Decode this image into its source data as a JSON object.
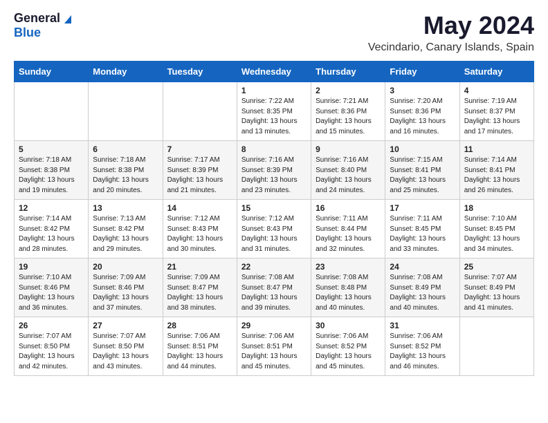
{
  "logo": {
    "general": "General",
    "blue": "Blue"
  },
  "title": {
    "month": "May 2024",
    "location": "Vecindario, Canary Islands, Spain"
  },
  "header": {
    "days": [
      "Sunday",
      "Monday",
      "Tuesday",
      "Wednesday",
      "Thursday",
      "Friday",
      "Saturday"
    ]
  },
  "weeks": [
    {
      "cells": [
        {
          "day": "",
          "content": ""
        },
        {
          "day": "",
          "content": ""
        },
        {
          "day": "",
          "content": ""
        },
        {
          "day": "1",
          "content": "Sunrise: 7:22 AM\nSunset: 8:35 PM\nDaylight: 13 hours and 13 minutes."
        },
        {
          "day": "2",
          "content": "Sunrise: 7:21 AM\nSunset: 8:36 PM\nDaylight: 13 hours and 15 minutes."
        },
        {
          "day": "3",
          "content": "Sunrise: 7:20 AM\nSunset: 8:36 PM\nDaylight: 13 hours and 16 minutes."
        },
        {
          "day": "4",
          "content": "Sunrise: 7:19 AM\nSunset: 8:37 PM\nDaylight: 13 hours and 17 minutes."
        }
      ]
    },
    {
      "cells": [
        {
          "day": "5",
          "content": "Sunrise: 7:18 AM\nSunset: 8:38 PM\nDaylight: 13 hours and 19 minutes."
        },
        {
          "day": "6",
          "content": "Sunrise: 7:18 AM\nSunset: 8:38 PM\nDaylight: 13 hours and 20 minutes."
        },
        {
          "day": "7",
          "content": "Sunrise: 7:17 AM\nSunset: 8:39 PM\nDaylight: 13 hours and 21 minutes."
        },
        {
          "day": "8",
          "content": "Sunrise: 7:16 AM\nSunset: 8:39 PM\nDaylight: 13 hours and 23 minutes."
        },
        {
          "day": "9",
          "content": "Sunrise: 7:16 AM\nSunset: 8:40 PM\nDaylight: 13 hours and 24 minutes."
        },
        {
          "day": "10",
          "content": "Sunrise: 7:15 AM\nSunset: 8:41 PM\nDaylight: 13 hours and 25 minutes."
        },
        {
          "day": "11",
          "content": "Sunrise: 7:14 AM\nSunset: 8:41 PM\nDaylight: 13 hours and 26 minutes."
        }
      ]
    },
    {
      "cells": [
        {
          "day": "12",
          "content": "Sunrise: 7:14 AM\nSunset: 8:42 PM\nDaylight: 13 hours and 28 minutes."
        },
        {
          "day": "13",
          "content": "Sunrise: 7:13 AM\nSunset: 8:42 PM\nDaylight: 13 hours and 29 minutes."
        },
        {
          "day": "14",
          "content": "Sunrise: 7:12 AM\nSunset: 8:43 PM\nDaylight: 13 hours and 30 minutes."
        },
        {
          "day": "15",
          "content": "Sunrise: 7:12 AM\nSunset: 8:43 PM\nDaylight: 13 hours and 31 minutes."
        },
        {
          "day": "16",
          "content": "Sunrise: 7:11 AM\nSunset: 8:44 PM\nDaylight: 13 hours and 32 minutes."
        },
        {
          "day": "17",
          "content": "Sunrise: 7:11 AM\nSunset: 8:45 PM\nDaylight: 13 hours and 33 minutes."
        },
        {
          "day": "18",
          "content": "Sunrise: 7:10 AM\nSunset: 8:45 PM\nDaylight: 13 hours and 34 minutes."
        }
      ]
    },
    {
      "cells": [
        {
          "day": "19",
          "content": "Sunrise: 7:10 AM\nSunset: 8:46 PM\nDaylight: 13 hours and 36 minutes."
        },
        {
          "day": "20",
          "content": "Sunrise: 7:09 AM\nSunset: 8:46 PM\nDaylight: 13 hours and 37 minutes."
        },
        {
          "day": "21",
          "content": "Sunrise: 7:09 AM\nSunset: 8:47 PM\nDaylight: 13 hours and 38 minutes."
        },
        {
          "day": "22",
          "content": "Sunrise: 7:08 AM\nSunset: 8:47 PM\nDaylight: 13 hours and 39 minutes."
        },
        {
          "day": "23",
          "content": "Sunrise: 7:08 AM\nSunset: 8:48 PM\nDaylight: 13 hours and 40 minutes."
        },
        {
          "day": "24",
          "content": "Sunrise: 7:08 AM\nSunset: 8:49 PM\nDaylight: 13 hours and 40 minutes."
        },
        {
          "day": "25",
          "content": "Sunrise: 7:07 AM\nSunset: 8:49 PM\nDaylight: 13 hours and 41 minutes."
        }
      ]
    },
    {
      "cells": [
        {
          "day": "26",
          "content": "Sunrise: 7:07 AM\nSunset: 8:50 PM\nDaylight: 13 hours and 42 minutes."
        },
        {
          "day": "27",
          "content": "Sunrise: 7:07 AM\nSunset: 8:50 PM\nDaylight: 13 hours and 43 minutes."
        },
        {
          "day": "28",
          "content": "Sunrise: 7:06 AM\nSunset: 8:51 PM\nDaylight: 13 hours and 44 minutes."
        },
        {
          "day": "29",
          "content": "Sunrise: 7:06 AM\nSunset: 8:51 PM\nDaylight: 13 hours and 45 minutes."
        },
        {
          "day": "30",
          "content": "Sunrise: 7:06 AM\nSunset: 8:52 PM\nDaylight: 13 hours and 45 minutes."
        },
        {
          "day": "31",
          "content": "Sunrise: 7:06 AM\nSunset: 8:52 PM\nDaylight: 13 hours and 46 minutes."
        },
        {
          "day": "",
          "content": ""
        }
      ]
    }
  ]
}
